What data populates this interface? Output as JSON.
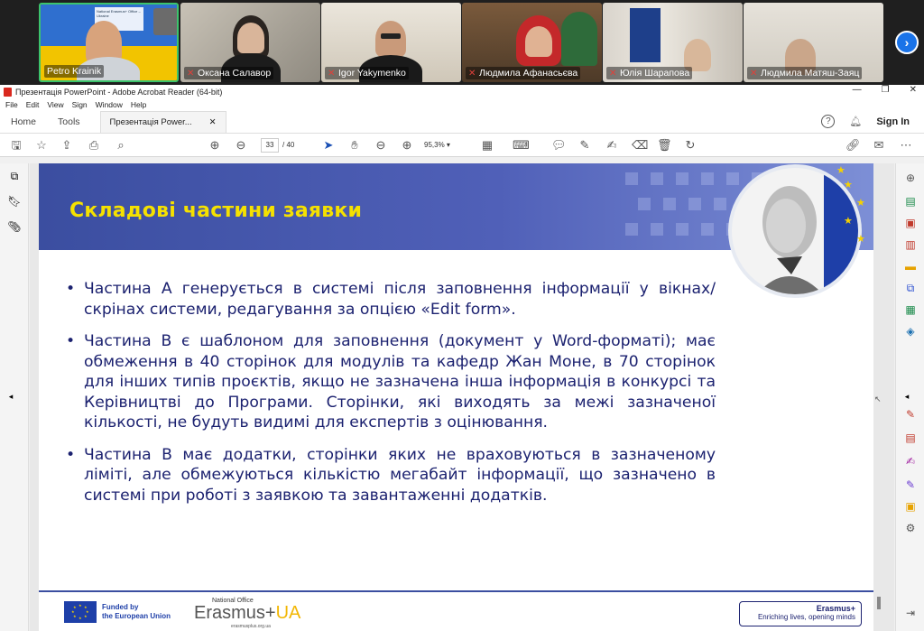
{
  "participants": [
    {
      "name": "Petro Krainik",
      "muted": false,
      "active": true,
      "shared_label": "National Erasmus+ Office – Ukraine"
    },
    {
      "name": "Оксана Салавор",
      "muted": true
    },
    {
      "name": "Igor Yakymenko",
      "muted": true
    },
    {
      "name": "Людмила Афанасьєва",
      "muted": true
    },
    {
      "name": "Юлія Шарапова",
      "muted": true
    },
    {
      "name": "Людмила Матяш-Заяц",
      "muted": true
    }
  ],
  "window": {
    "title": "Презентація PowerPoint - Adobe Acrobat Reader (64-bit)",
    "menu": [
      "File",
      "Edit",
      "View",
      "Sign",
      "Window",
      "Help"
    ],
    "nav": {
      "home": "Home",
      "tools": "Tools"
    },
    "doc_tab": "Презентація Power...",
    "sign_in": "Sign In"
  },
  "toolbar": {
    "page_current": "33",
    "page_total": "/ 40",
    "zoom": "95,3%"
  },
  "slide": {
    "title": "Складові частини заявки",
    "bullets": [
      "Частина А генерується в системі після заповнення інформації у вікнах/скрінах системи, редагування за опцією «Edit form».",
      "Частина В є шаблоном для заповнення (документ у Word-форматі); має обмеження в 40 сторінок для модулів та кафедр Жан Моне, в 70 сторінок для інших типів проєктів, якщо не зазначена інша інформація в конкурсі та Керівництві до Програми. Сторінки, які виходять за межі зазначеної кількості, не будуть видимі для експертів з оцінювання.",
      "Частина В має додатки, сторінки яких не враховуються в зазначеному ліміті, але обмежуються кількістю мегабайт інформації, що зазначено в системі при роботі з заявкою та завантаженні додатків."
    ],
    "footer": {
      "funded": "Funded by\nthe European Union",
      "national_office": "National Office",
      "erasmus_ua_main": "Erasmus+",
      "erasmus_ua_suffix": "UA",
      "erasmus_site": "erasmusplus.org.ua",
      "tagline_brand": "Erasmus+",
      "tagline_text": "Enriching lives, opening minds"
    }
  },
  "colors": {
    "slide_title": "#f5e100",
    "slide_text": "#1c2270",
    "header_blue": "#3b4ea0",
    "active_tile_border": "#3cc36c"
  }
}
